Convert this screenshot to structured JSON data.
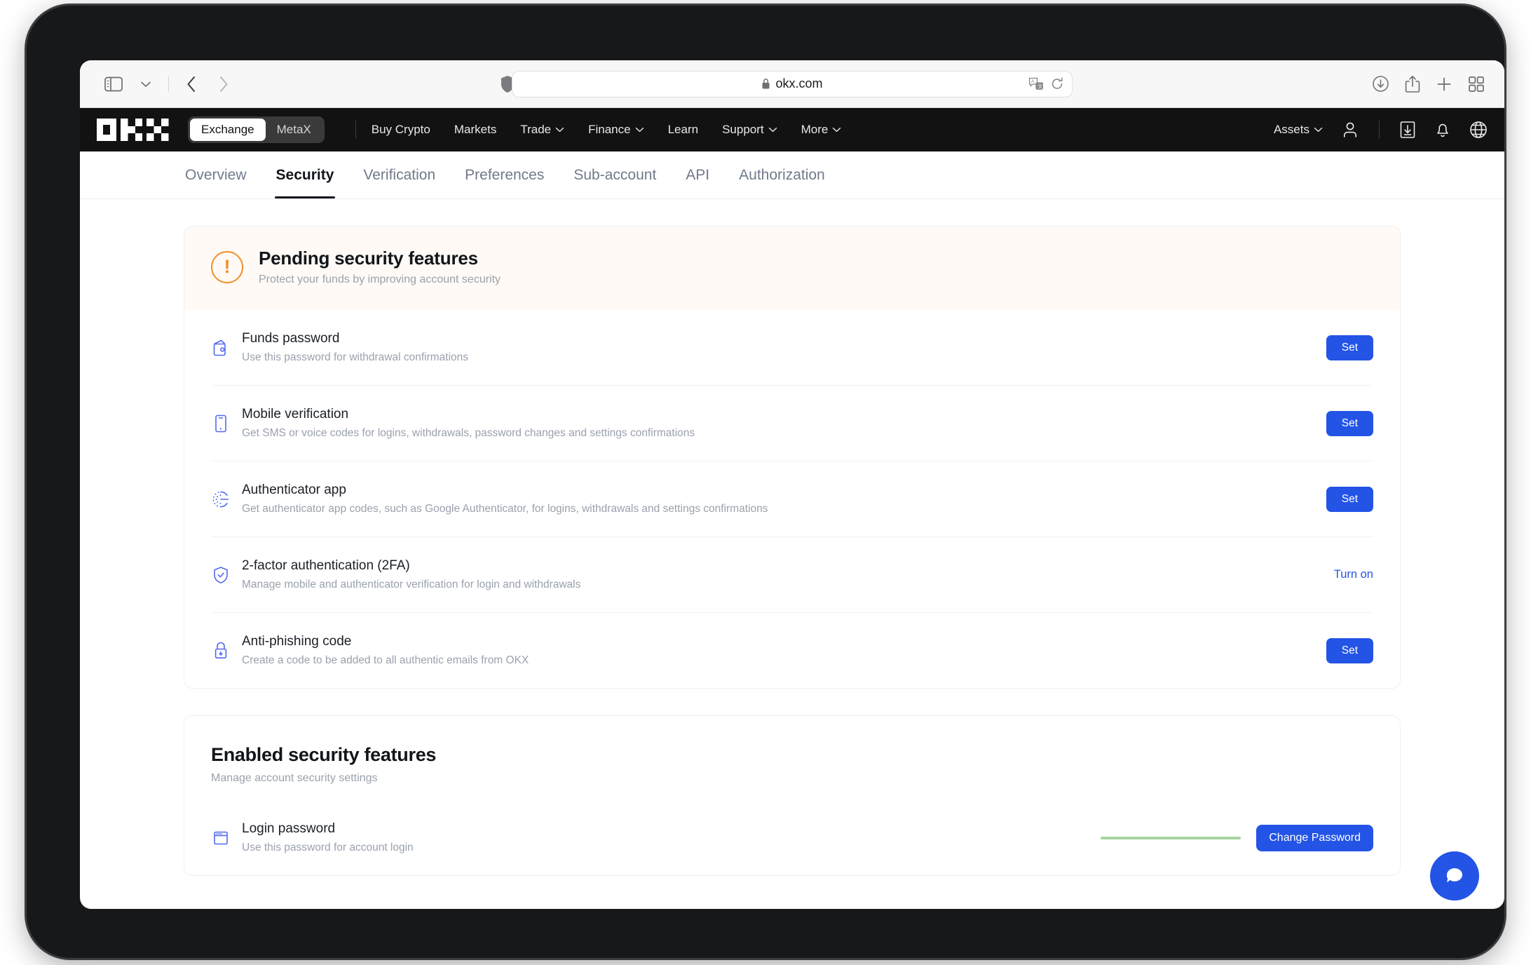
{
  "browser": {
    "url": "okx.com",
    "icons": {
      "sidebar": "sidebar-icon",
      "sidebar_chevron": "chevron-down-icon",
      "back": "back-arrow-icon",
      "forward": "forward-arrow-icon",
      "shield": "privacy-shield-icon",
      "lock": "lock-icon",
      "translate": "translate-icon",
      "reload": "reload-icon",
      "downloads": "downloads-icon",
      "share": "share-icon",
      "new_tab": "plus-icon",
      "tab_overview": "tab-overview-icon"
    }
  },
  "topnav": {
    "logo": "OKX",
    "segments": [
      {
        "label": "Exchange",
        "active": true
      },
      {
        "label": "MetaX",
        "active": false
      }
    ],
    "items": [
      {
        "label": "Buy Crypto",
        "chevron": false
      },
      {
        "label": "Markets",
        "chevron": false
      },
      {
        "label": "Trade",
        "chevron": true
      },
      {
        "label": "Finance",
        "chevron": true
      },
      {
        "label": "Learn",
        "chevron": false
      },
      {
        "label": "Support",
        "chevron": true
      },
      {
        "label": "More",
        "chevron": true
      }
    ],
    "assets_label": "Assets",
    "right_icons": [
      "user-icon",
      "download-app-icon",
      "notification-bell-icon",
      "language-globe-icon"
    ]
  },
  "subtabs": [
    {
      "label": "Overview",
      "active": false
    },
    {
      "label": "Security",
      "active": true
    },
    {
      "label": "Verification",
      "active": false
    },
    {
      "label": "Preferences",
      "active": false
    },
    {
      "label": "Sub-account",
      "active": false
    },
    {
      "label": "API",
      "active": false
    },
    {
      "label": "Authorization",
      "active": false
    }
  ],
  "pending": {
    "icon": "warning-exclamation-icon",
    "title": "Pending security features",
    "subtitle": "Protect your funds by improving account security",
    "rows": [
      {
        "icon": "wallet-icon",
        "title": "Funds password",
        "desc": "Use this password for withdrawal confirmations",
        "action": "Set",
        "action_type": "button"
      },
      {
        "icon": "mobile-phone-icon",
        "title": "Mobile verification",
        "desc": "Get SMS or voice codes for logins, withdrawals, password changes and settings confirmations",
        "action": "Set",
        "action_type": "button"
      },
      {
        "icon": "authenticator-timer-icon",
        "title": "Authenticator app",
        "desc": "Get authenticator app codes, such as Google Authenticator, for logins, withdrawals and settings confirmations",
        "action": "Set",
        "action_type": "button"
      },
      {
        "icon": "shield-check-icon",
        "title": "2-factor authentication (2FA)",
        "desc": "Manage mobile and authenticator verification for login and withdrawals",
        "action": "Turn on",
        "action_type": "link"
      },
      {
        "icon": "lock-icon",
        "title": "Anti-phishing code",
        "desc": "Create a code to be added to all authentic emails from OKX",
        "action": "Set",
        "action_type": "button"
      }
    ]
  },
  "enabled": {
    "title": "Enabled security features",
    "subtitle": "Manage account security settings",
    "rows": [
      {
        "icon": "browser-window-icon",
        "title": "Login password",
        "desc": "Use this password for account login",
        "strength": "password-strength-bar",
        "action": "Change Password",
        "action_type": "button"
      }
    ]
  },
  "chat": {
    "icon": "chat-bubble-icon"
  },
  "colors": {
    "accent_blue": "#2354e6",
    "icon_blue": "#5068f2",
    "warning_orange": "#f0912b",
    "banner_bg": "#fffaf5",
    "strength_green": "#a8d3a0",
    "nav_black": "#121212"
  }
}
